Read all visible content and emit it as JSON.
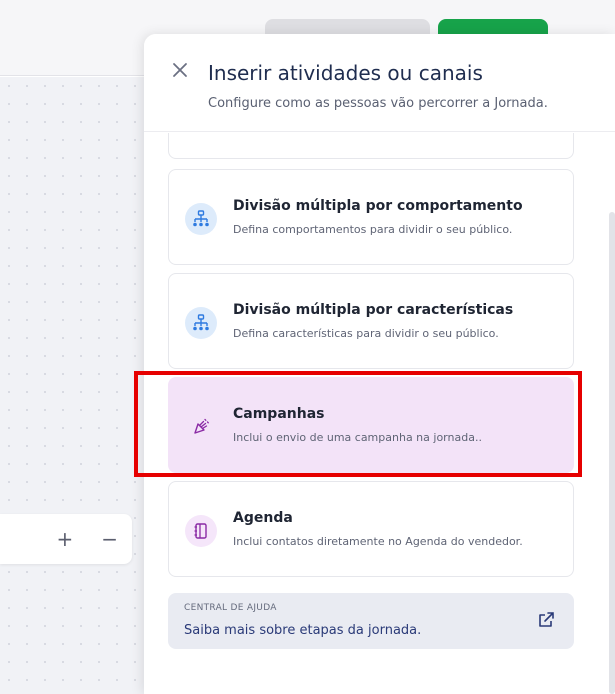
{
  "panel": {
    "title": "Inserir atividades ou canais",
    "subtitle": "Configure como as pessoas vão percorrer a Jornada."
  },
  "cards": [
    {
      "title": "Divisão múltipla por comportamento",
      "description": "Defina comportamentos para dividir o seu público.",
      "icon": "split-tree-icon"
    },
    {
      "title": "Divisão múltipla por características",
      "description": "Defina características para dividir o seu público.",
      "icon": "split-tree-icon"
    },
    {
      "title": "Campanhas",
      "description": "Inclui o envio de uma campanha na jornada..",
      "icon": "megaphone-icon"
    },
    {
      "title": "Agenda",
      "description": "Inclui contatos diretamente no Agenda do vendedor.",
      "icon": "notebook-icon"
    }
  ],
  "help": {
    "label": "CENTRAL DE AJUDA",
    "link_text": "Saiba mais sobre etapas da jornada."
  },
  "zoom": {
    "plus": "+",
    "minus": "−"
  },
  "colors": {
    "highlight_border": "#e60000",
    "selected_card_bg": "#f3e3f8",
    "primary_button": "#17a34a",
    "title_color": "#1f2d4f"
  }
}
